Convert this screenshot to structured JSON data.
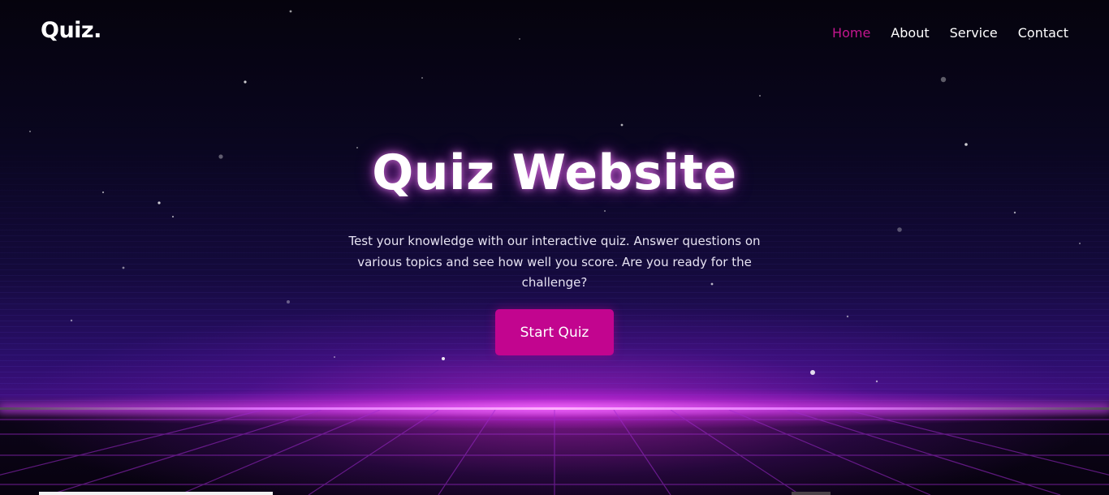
{
  "navbar": {
    "logo": "Quiz.",
    "links": [
      {
        "label": "Home",
        "active": true
      },
      {
        "label": "About",
        "active": false
      },
      {
        "label": "Service",
        "active": false
      },
      {
        "label": "Contact",
        "active": false
      }
    ]
  },
  "hero": {
    "title": "Quiz Website",
    "description": "Test your knowledge with our interactive quiz. Answer questions on various topics and see how well you score. Are you ready for the challenge?",
    "button_label": "Start Quiz"
  },
  "colors": {
    "accent": "#c2058f",
    "nav_active": "#c4168f",
    "glow": "#e070ff",
    "background": "#07040f"
  }
}
